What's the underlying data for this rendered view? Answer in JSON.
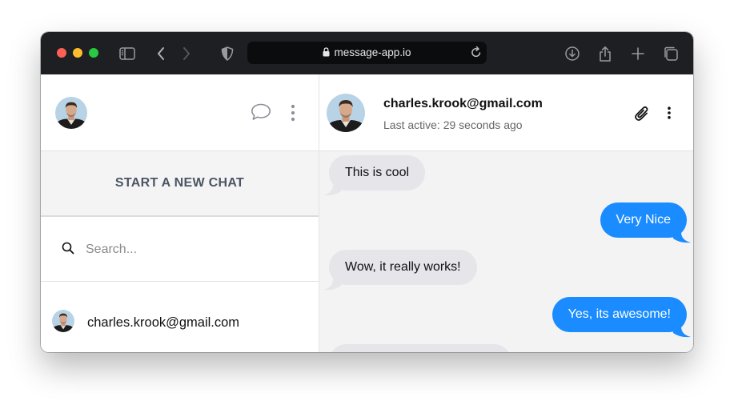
{
  "browser": {
    "url": "message-app.io"
  },
  "sidebar": {
    "new_chat_label": "START A NEW CHAT",
    "search_placeholder": "Search...",
    "contacts": [
      {
        "email": "charles.krook@gmail.com"
      }
    ]
  },
  "chat": {
    "contact_email": "charles.krook@gmail.com",
    "status": "Last active: 29 seconds ago",
    "messages": [
      {
        "text": "This is cool",
        "direction": "in"
      },
      {
        "text": "Very Nice",
        "direction": "out"
      },
      {
        "text": "Wow, it really works!",
        "direction": "in"
      },
      {
        "text": "Yes, its awesome!",
        "direction": "out"
      }
    ]
  },
  "colors": {
    "outgoing_bubble": "#1a8cff",
    "incoming_bubble": "#e5e5ea",
    "titlebar": "#1e1f22"
  }
}
